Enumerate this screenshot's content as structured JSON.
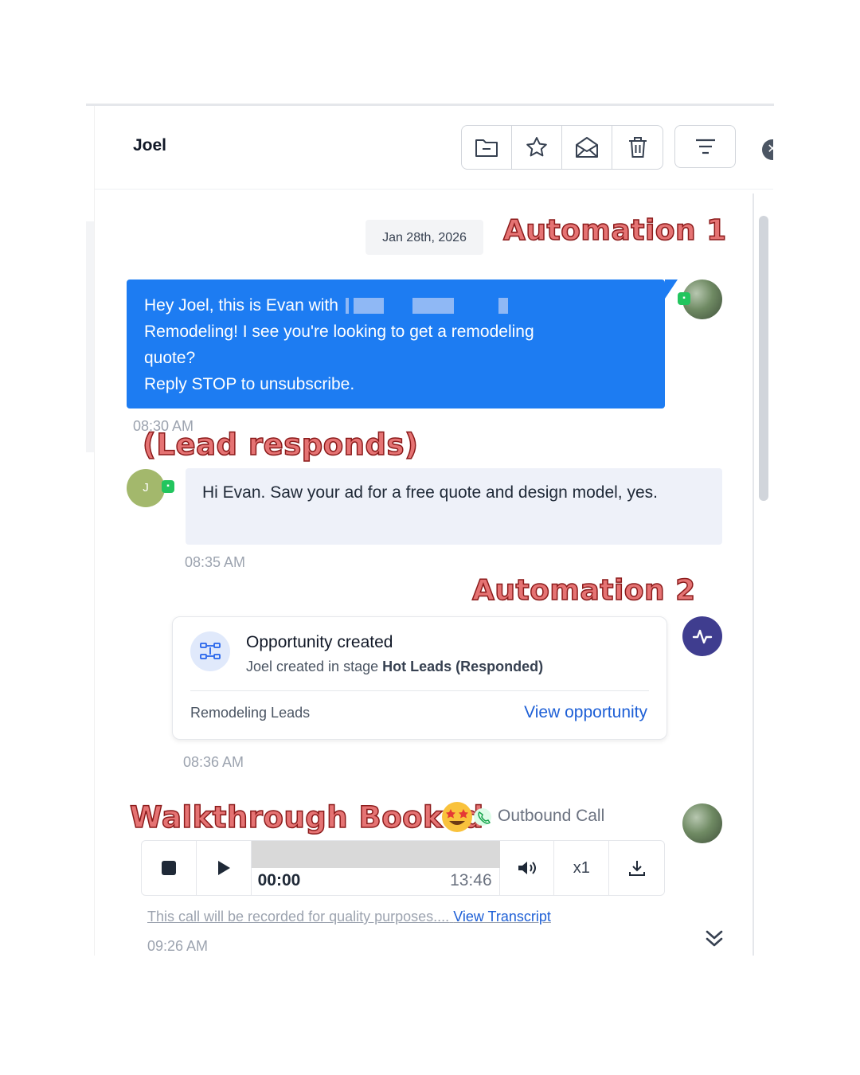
{
  "header": {
    "contact_name": "Joel",
    "tools": [
      {
        "icon": "folder-icon",
        "name": "archive-button"
      },
      {
        "icon": "star-icon",
        "name": "star-button"
      },
      {
        "icon": "envelope-open-icon",
        "name": "mark-unread-button"
      },
      {
        "icon": "trash-icon",
        "name": "delete-button"
      }
    ],
    "filter_icon": "filter-lines-icon",
    "close_glyph": "✕"
  },
  "conversation": {
    "date_chip": "Jan 28th, 2026",
    "annotations": {
      "automation1": "Automation 1",
      "lead_responds": "(Lead responds)",
      "automation2": "Automation 2",
      "walkthrough": "Walkthrough Booked"
    },
    "outbound_message": {
      "line1_prefix": "Hey Joel, this is Evan with",
      "line2": "Remodeling! I see you're looking to get a remodeling",
      "line3": "quote?",
      "line4": "Reply STOP to unsubscribe.",
      "time": "08:30 AM"
    },
    "inbound_message": {
      "avatar_initial": "J",
      "text": "Hi Evan. Saw your ad for a free quote and design model, yes.",
      "time": "08:35 AM"
    },
    "opportunity": {
      "title": "Opportunity created",
      "sub_prefix": "Joel created in stage",
      "stage": "Hot Leads (Responded)",
      "pipeline": "Remodeling Leads",
      "link": "View opportunity",
      "time": "08:36 AM"
    },
    "call": {
      "label": "Outbound Call",
      "current_time": "00:00",
      "duration": "13:46",
      "progress": 0,
      "speed": "x1",
      "note": "This call will be recorded for quality purposes....",
      "transcript_link": "View Transcript",
      "time": "09:26 AM"
    }
  },
  "colors": {
    "outbound_bubble": "#1d7cf2",
    "inbound_bubble": "#eef1f9",
    "link": "#1d5fd6",
    "annotation": "#e57373"
  }
}
